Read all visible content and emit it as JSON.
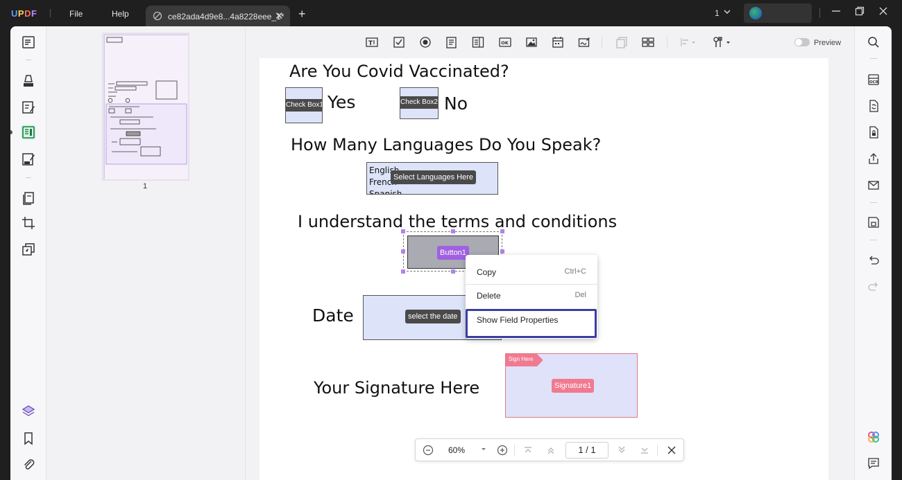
{
  "app": {
    "logo": "UPDF",
    "menu": [
      "File",
      "Help"
    ],
    "tab_title": "ce82ada4d9e8...4a8228eee_1*",
    "tab_close": "✕",
    "tab_add": "+",
    "page_indicator": "1"
  },
  "toolbar": {
    "preview_label": "Preview"
  },
  "thumbnails": {
    "page_label": "1"
  },
  "document": {
    "q_covid": "Are You Covid Vaccinated?",
    "checkbox1": "Check Box1",
    "yes": "Yes",
    "checkbox2": "Check Box2",
    "no": "No",
    "q_languages": "How Many Languages Do You Speak?",
    "languages": [
      "English",
      "French",
      "Spanish"
    ],
    "languages_tag": "Select Languages Here",
    "q_terms": "I understand the terms and conditions",
    "button_tag": "Button1",
    "date_label": "Date",
    "date_tag": "select the date",
    "signature_label": "Your Signature Here",
    "sign_flag": "Sign Here",
    "signature_tag": "Signature1"
  },
  "context_menu": {
    "items": [
      {
        "label": "Copy",
        "shortcut": "Ctrl+C"
      },
      {
        "label": "Delete",
        "shortcut": "Del"
      },
      {
        "label": "Show Field Properties",
        "shortcut": ""
      }
    ]
  },
  "zoom": {
    "level": "60%",
    "page": "1 / 1"
  },
  "colors": {
    "accent_purple": "#a060e0",
    "highlight_border": "#3b3ea0",
    "signature_pink": "#f07a90",
    "field_fill": "#dde3f8"
  }
}
